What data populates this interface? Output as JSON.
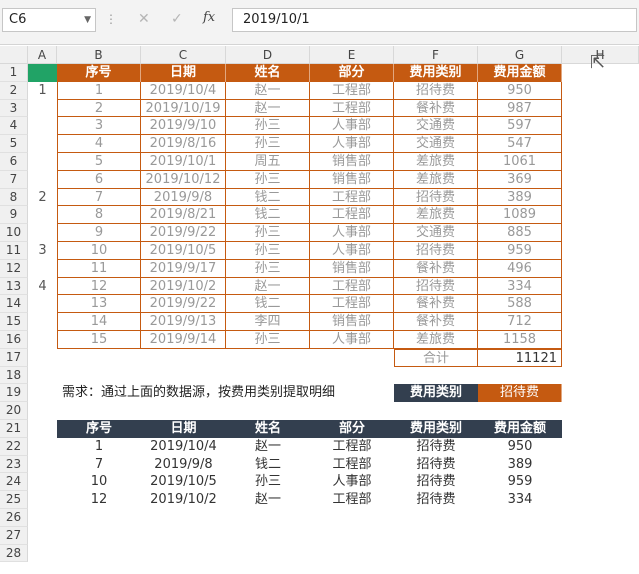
{
  "formula_bar": {
    "name_box": "C6",
    "fx_label": "fx",
    "cancel_icon": "✕",
    "confirm_icon": "✓",
    "formula": "2019/10/1"
  },
  "columns": [
    "A",
    "B",
    "C",
    "D",
    "E",
    "F",
    "G",
    "H"
  ],
  "row_numbers": [
    "1",
    "2",
    "3",
    "4",
    "5",
    "6",
    "7",
    "8",
    "9",
    "10",
    "11",
    "12",
    "13",
    "14",
    "15",
    "16",
    "17",
    "18",
    "19",
    "20",
    "21",
    "22",
    "23",
    "24",
    "25",
    "26",
    "27",
    "28"
  ],
  "source_table": {
    "headers": [
      "序号",
      "日期",
      "姓名",
      "部分",
      "费用类别",
      "费用金额"
    ],
    "rows": [
      [
        "1",
        "2019/10/4",
        "赵一",
        "工程部",
        "招待费",
        "950"
      ],
      [
        "2",
        "2019/10/19",
        "赵一",
        "工程部",
        "餐补费",
        "987"
      ],
      [
        "3",
        "2019/9/10",
        "孙三",
        "人事部",
        "交通费",
        "597"
      ],
      [
        "4",
        "2019/8/16",
        "孙三",
        "人事部",
        "交通费",
        "547"
      ],
      [
        "5",
        "2019/10/1",
        "周五",
        "销售部",
        "差旅费",
        "1061"
      ],
      [
        "6",
        "2019/10/12",
        "孙三",
        "销售部",
        "差旅费",
        "369"
      ],
      [
        "7",
        "2019/9/8",
        "钱二",
        "工程部",
        "招待费",
        "389"
      ],
      [
        "8",
        "2019/8/21",
        "钱二",
        "工程部",
        "差旅费",
        "1089"
      ],
      [
        "9",
        "2019/9/22",
        "孙三",
        "人事部",
        "交通费",
        "885"
      ],
      [
        "10",
        "2019/10/5",
        "孙三",
        "人事部",
        "招待费",
        "959"
      ],
      [
        "11",
        "2019/9/17",
        "孙三",
        "销售部",
        "餐补费",
        "496"
      ],
      [
        "12",
        "2019/10/2",
        "赵一",
        "工程部",
        "招待费",
        "334"
      ],
      [
        "13",
        "2019/9/22",
        "钱二",
        "工程部",
        "餐补费",
        "588"
      ],
      [
        "14",
        "2019/9/13",
        "李四",
        "销售部",
        "餐补费",
        "712"
      ],
      [
        "15",
        "2019/9/14",
        "孙三",
        "人事部",
        "差旅费",
        "1158"
      ]
    ],
    "total_label": "合计",
    "total_value": "11121"
  },
  "group_markers": [
    "1",
    "2",
    "3",
    "4"
  ],
  "requirement": {
    "text": "需求：通过上面的数据源，按费用类别提取明细",
    "criteria_label": "费用类别",
    "criteria_value": "招待费"
  },
  "result_table": {
    "headers": [
      "序号",
      "日期",
      "姓名",
      "部分",
      "费用类别",
      "费用金额"
    ],
    "rows": [
      [
        "1",
        "2019/10/4",
        "赵一",
        "工程部",
        "招待费",
        "950"
      ],
      [
        "7",
        "2019/9/8",
        "钱二",
        "工程部",
        "招待费",
        "389"
      ],
      [
        "10",
        "2019/10/5",
        "孙三",
        "人事部",
        "招待费",
        "959"
      ],
      [
        "12",
        "2019/10/2",
        "赵一",
        "工程部",
        "招待费",
        "334"
      ]
    ]
  },
  "colors": {
    "orange": "#c55a11",
    "dark_header": "#333f4f",
    "selection": "#21a366"
  }
}
